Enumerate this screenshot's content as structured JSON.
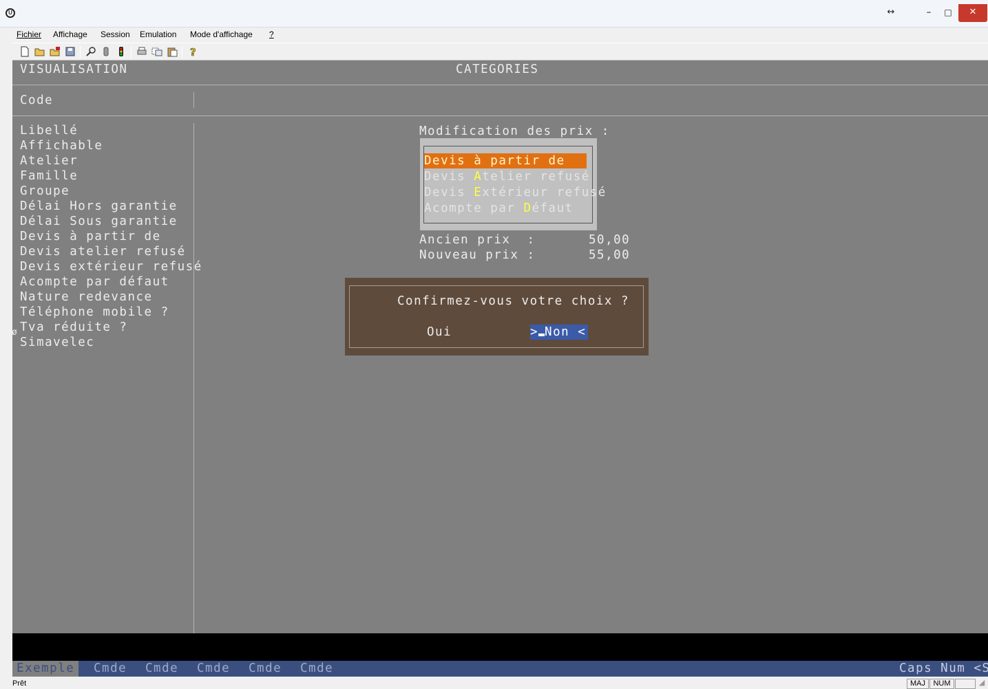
{
  "window": {
    "resize_glyph": "↔",
    "min_glyph": "–",
    "max_glyph": "□",
    "close_glyph": "✕"
  },
  "menubar": [
    "Fichier",
    "Affichage",
    "Session",
    "Emulation",
    "Mode d'affichage",
    "?"
  ],
  "toolbar_icons": [
    "new-icon",
    "open-icon",
    "open-session-icon",
    "save-icon",
    "search-icon",
    "disconnect-icon",
    "traffic-light-icon",
    "print-icon",
    "copy-icon",
    "paste-icon",
    "help-icon"
  ],
  "terminal": {
    "mode": "VISUALISATION",
    "screen_title": "CATEGORIES",
    "code_label": "Code",
    "field_labels": [
      "Libellé",
      "Affichable",
      "Atelier",
      "Famille",
      "Groupe",
      "Délai Hors garantie",
      "Délai Sous garantie",
      "Devis à partir de",
      "Devis atelier refusé",
      "Devis extérieur refusé",
      "Acompte par défaut",
      "Nature redevance",
      "Téléphone mobile ?",
      "Tva réduite ?",
      "Simavelec"
    ],
    "marker_glyph": "ø"
  },
  "price_menu": {
    "title": "Modification des prix :",
    "items": [
      {
        "before": "Devis à partir de",
        "hot": "",
        "after": ""
      },
      {
        "before": "Devis ",
        "hot": "A",
        "after": "telier refusé"
      },
      {
        "before": "Devis ",
        "hot": "E",
        "after": "xtérieur refusé"
      },
      {
        "before": "Acompte par ",
        "hot": "D",
        "after": "éfaut"
      }
    ],
    "active_index": 0,
    "old_price_label": "Ancien prix  :",
    "old_price_value": "50,00",
    "new_price_label": "Nouveau prix :",
    "new_price_value": "55,00"
  },
  "confirm_dialog": {
    "question": "Confirmez-vous votre choix ?",
    "yes_label": "Oui",
    "no_prefix": ">",
    "no_label": "Non <"
  },
  "fkeys": [
    "Exemple",
    "Cmde",
    "Cmde",
    "Cmde",
    "Cmde",
    "Cmde"
  ],
  "fkeys_right": "Caps Num <S>",
  "status": {
    "text": "Prêt",
    "indicators": [
      "MAJ",
      "NUM",
      ""
    ]
  },
  "colors": {
    "terminal_bg": "#808080",
    "menu_highlight": "#e17013",
    "hotkey": "#ffff40",
    "dialog_bg": "#5f4b3c",
    "selected_button": "#3b5aa8",
    "fkey_bar": "#3a4f80"
  }
}
